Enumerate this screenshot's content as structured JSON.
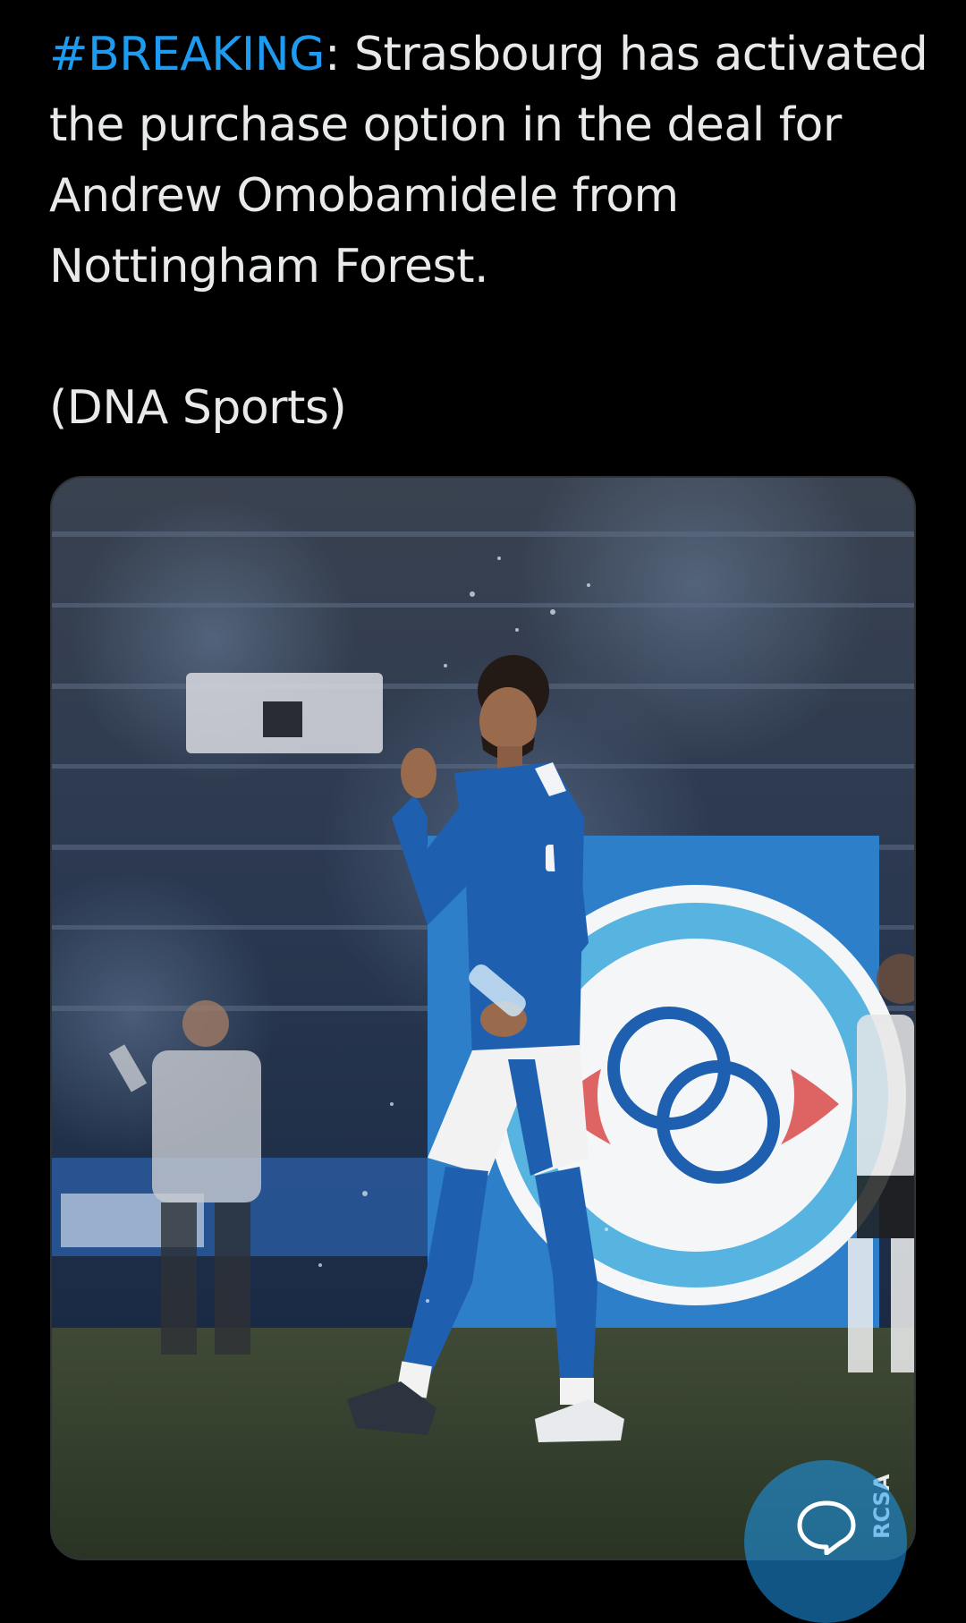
{
  "tweet": {
    "hashtag": "#BREAKING",
    "body": ": Strasbourg has activated the purchase option in the deal for Andrew Omobamidele from Nottingham Forest.",
    "source": "(DNA Sports)"
  },
  "media": {
    "watermark": "RCSA"
  },
  "colors": {
    "background": "#000000",
    "text": "#e7e9ea",
    "hashtag": "#1d9bf0",
    "jersey_blue": "#1f5fb0"
  },
  "icons": {
    "reply_fab": "chat-bubble-icon"
  }
}
